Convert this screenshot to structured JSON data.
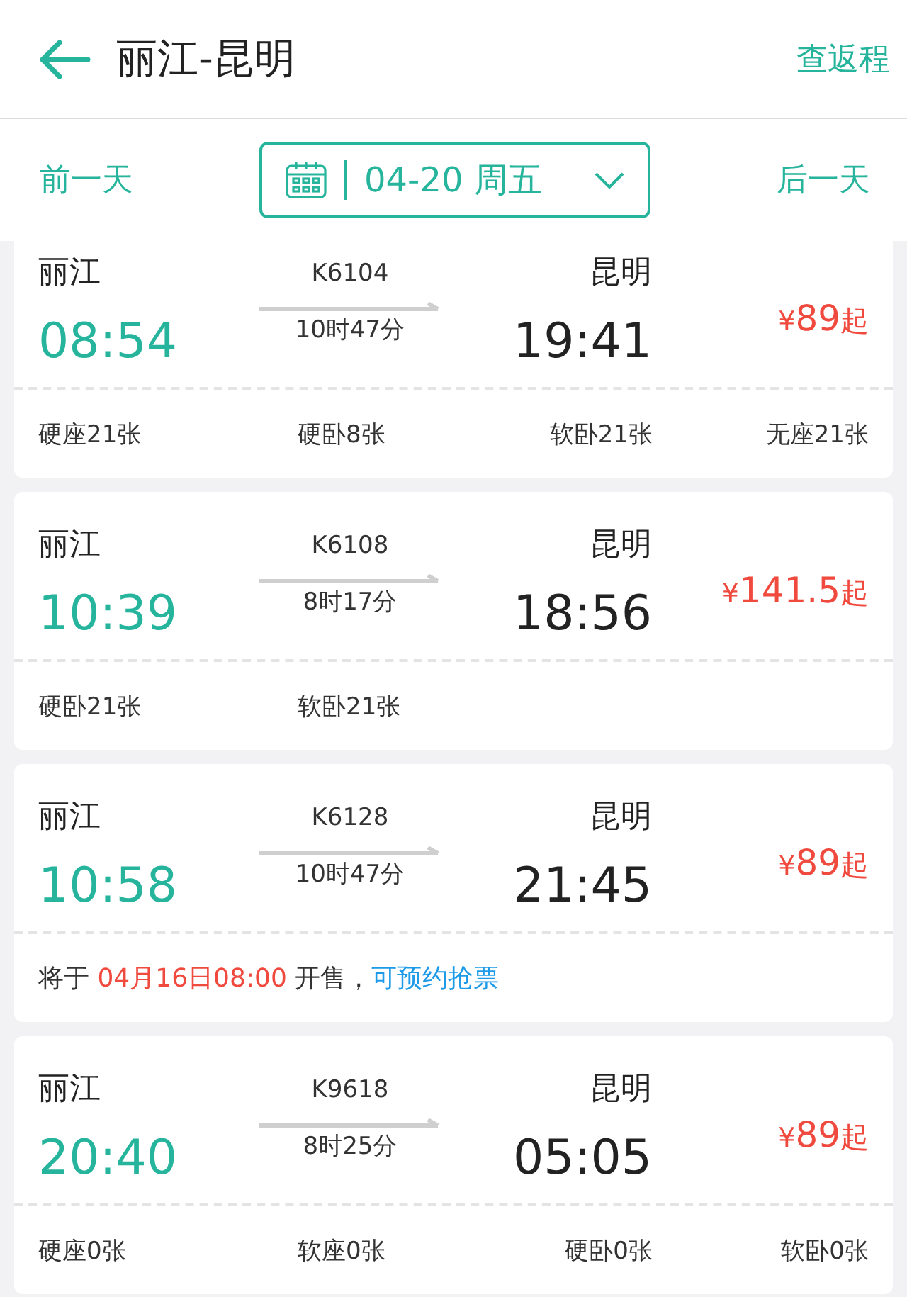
{
  "header": {
    "title": "丽江-昆明",
    "return_link": "查返程"
  },
  "date_bar": {
    "prev": "前一天",
    "date": "04-20 周五",
    "next": "后一天"
  },
  "trains": [
    {
      "from": "丽江",
      "depart": "08:54",
      "train_no": "K6104",
      "duration": "10时47分",
      "to": "昆明",
      "arrive": "19:41",
      "price": {
        "currency": "¥",
        "amount": "89",
        "suffix": "起"
      },
      "footer": {
        "kind": "seats",
        "seats": [
          "硬座21张",
          "硬卧8张",
          "软卧21张",
          "无座21张"
        ]
      }
    },
    {
      "from": "丽江",
      "depart": "10:39",
      "train_no": "K6108",
      "duration": "8时17分",
      "to": "昆明",
      "arrive": "18:56",
      "price": {
        "currency": "¥",
        "amount": "141.5",
        "suffix": "起"
      },
      "footer": {
        "kind": "seats",
        "seats": [
          "硬卧21张",
          "软卧21张"
        ]
      }
    },
    {
      "from": "丽江",
      "depart": "10:58",
      "train_no": "K6128",
      "duration": "10时47分",
      "to": "昆明",
      "arrive": "21:45",
      "price": {
        "currency": "¥",
        "amount": "89",
        "suffix": "起"
      },
      "footer": {
        "kind": "notice",
        "parts": [
          {
            "kind": "text",
            "text": "将于 "
          },
          {
            "kind": "time",
            "text": "04月16日08:00"
          },
          {
            "kind": "text",
            "text": " 开售，"
          },
          {
            "kind": "link",
            "text": "可预约抢票"
          }
        ]
      }
    },
    {
      "from": "丽江",
      "depart": "20:40",
      "train_no": "K9618",
      "duration": "8时25分",
      "to": "昆明",
      "arrive": "05:05",
      "price": {
        "currency": "¥",
        "amount": "89",
        "suffix": "起"
      },
      "footer": {
        "kind": "seats",
        "seats": [
          "硬座0张",
          "软座0张",
          "硬卧0张",
          "软卧0张"
        ]
      }
    }
  ]
}
